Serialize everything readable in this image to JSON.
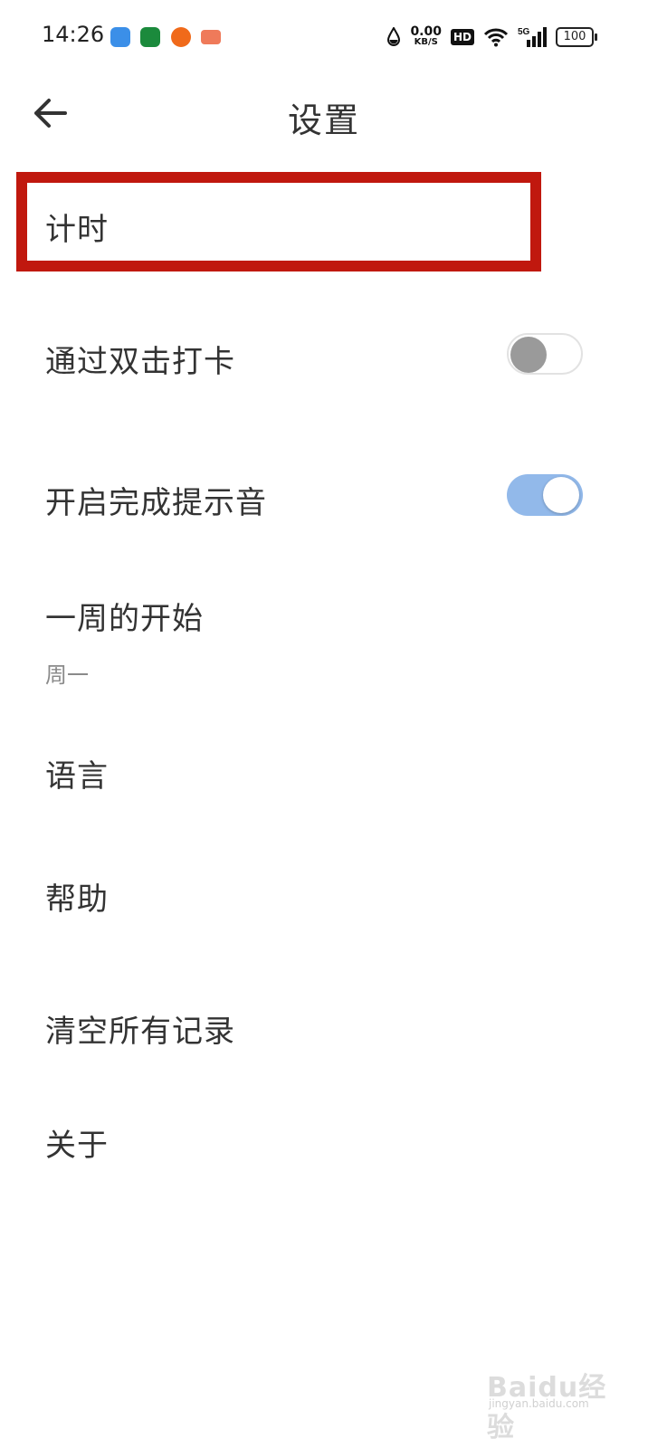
{
  "status_bar": {
    "time": "14:26",
    "net_speed_value": "0.00",
    "net_speed_unit": "KB/S",
    "hd_label": "HD",
    "network_label": "5G",
    "battery_level": "100",
    "app_icons": [
      "blue-leaf-app-icon",
      "oppo-app-icon",
      "orange-app-icon",
      "game-app-icon"
    ],
    "icons": [
      "water-drop-icon",
      "wifi-icon",
      "signal-bars-icon",
      "battery-icon"
    ]
  },
  "header": {
    "title": "设置",
    "back_icon": "arrow-left-icon"
  },
  "settings": {
    "timer": {
      "label": "计时"
    },
    "double_tap": {
      "label": "通过双击打卡",
      "enabled": false
    },
    "completion_sound": {
      "label": "开启完成提示音",
      "enabled": true
    },
    "week_start": {
      "label": "一周的开始",
      "value": "周一"
    },
    "language": {
      "label": "语言"
    },
    "help": {
      "label": "帮助"
    },
    "clear_records": {
      "label": "清空所有记录"
    },
    "about": {
      "label": "关于"
    }
  },
  "colors": {
    "highlight_border": "#c0180e",
    "toggle_on": "#92b9ea",
    "toggle_off_knob": "#9a9a9a",
    "text": "#333333",
    "subtext": "#8a8a8a"
  },
  "watermark": {
    "main": "Baidu经验",
    "sub": "jingyan.baidu.com"
  }
}
